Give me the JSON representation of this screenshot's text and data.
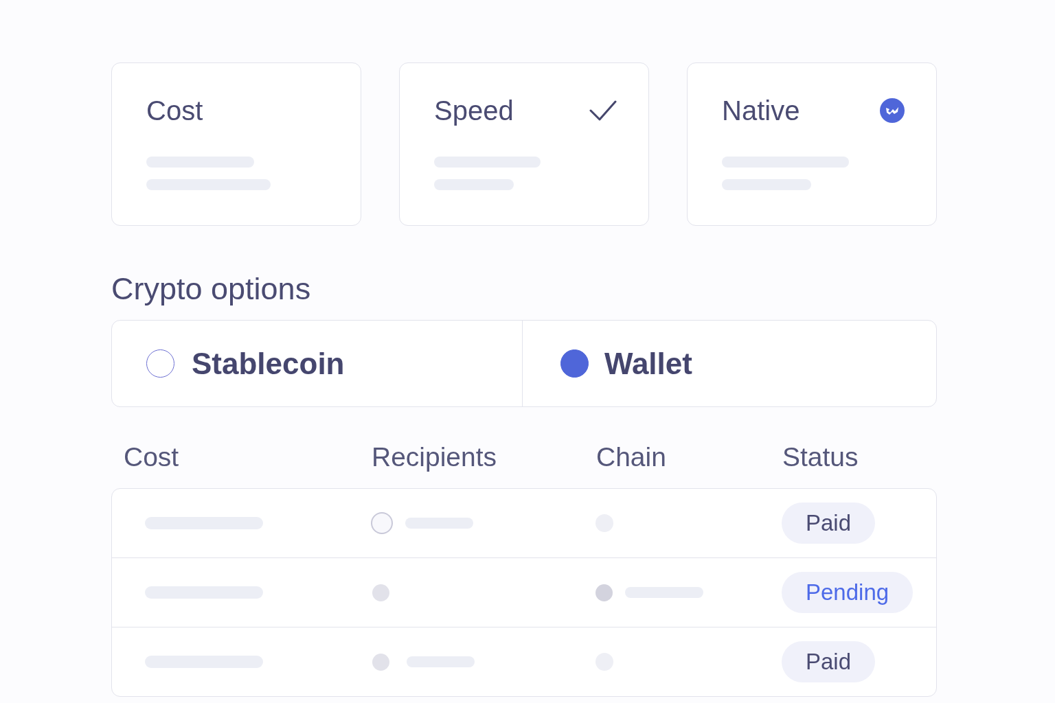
{
  "cards": [
    {
      "title": "Cost",
      "kind": "plain"
    },
    {
      "title": "Speed",
      "kind": "check"
    },
    {
      "title": "Native",
      "kind": "badge"
    }
  ],
  "crypto_options": {
    "title": "Crypto options",
    "options": [
      {
        "label": "Stablecoin",
        "selected": false
      },
      {
        "label": "Wallet",
        "selected": true
      }
    ]
  },
  "table": {
    "columns": [
      "Cost",
      "Recipients",
      "Chain",
      "Status"
    ],
    "rows": [
      {
        "recipients": {
          "kind": "ring",
          "line": true
        },
        "chain": {
          "kind": "faint",
          "line": false
        },
        "status": {
          "label": "Paid",
          "kind": "paid"
        }
      },
      {
        "recipients": {
          "kind": "soft",
          "line": false
        },
        "chain": {
          "kind": "strong",
          "line": true
        },
        "status": {
          "label": "Pending",
          "kind": "pending"
        }
      },
      {
        "recipients": {
          "kind": "soft",
          "line": true
        },
        "chain": {
          "kind": "faint",
          "line": false
        },
        "status": {
          "label": "Paid",
          "kind": "paid"
        }
      }
    ]
  }
}
